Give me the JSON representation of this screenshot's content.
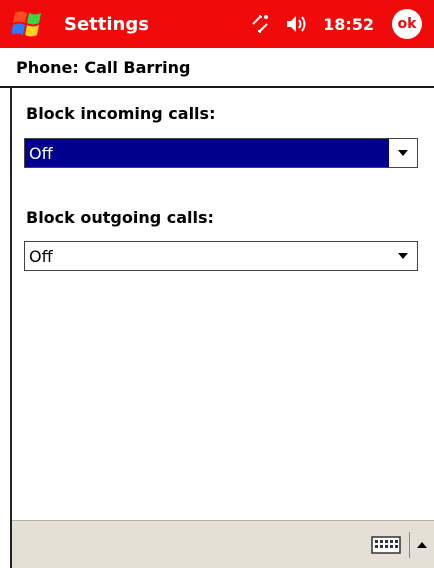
{
  "titlebar": {
    "title": "Settings",
    "time": "18:52",
    "ok_label": "ok"
  },
  "page": {
    "title": "Phone: Call Barring"
  },
  "incoming": {
    "label": "Block incoming calls:",
    "value": "Off"
  },
  "outgoing": {
    "label": "Block outgoing calls:",
    "value": "Off"
  },
  "icons": {
    "start": "windows-flag-icon",
    "connectivity": "connectivity-icon",
    "volume": "speaker-icon",
    "keyboard": "keyboard-icon",
    "sip_menu": "up-arrow-icon"
  },
  "colors": {
    "titlebar": "#f00a0a",
    "selection": "#00008c",
    "bottombar": "#e6dfd6"
  }
}
